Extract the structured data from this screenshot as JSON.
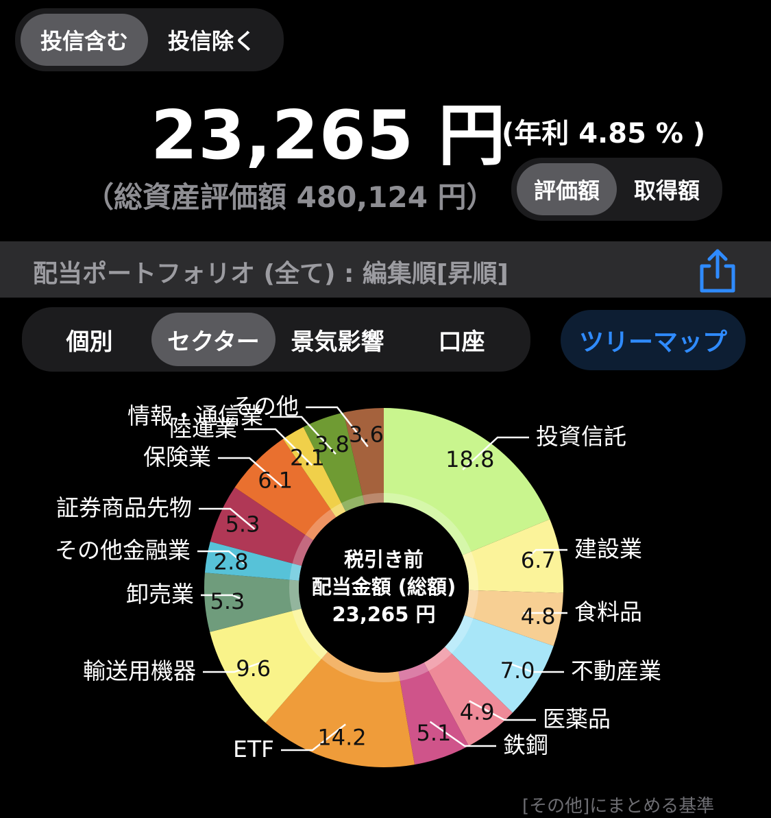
{
  "filter_toggle": {
    "include_funds": "投信含む",
    "exclude_funds": "投信除く"
  },
  "summary": {
    "amount": "23,265 円",
    "annual_rate": "(年利 4.85 % )",
    "total_assets": "（総資産評価額 480,124 円）"
  },
  "value_toggle": {
    "valuation": "評価額",
    "acquisition": "取得額"
  },
  "portfolio_bar": {
    "title": "配当ポートフォリオ (全て) : 編集順[昇順]",
    "share_icon": "share-icon"
  },
  "view_tabs": {
    "individual": "個別",
    "sector": "セクター",
    "business_sensitivity": "景気影響",
    "account": "口座"
  },
  "treemap_button": "ツリーマップ",
  "chart_data": {
    "type": "pie",
    "center_text": [
      "税引き前",
      "配当金額 (総額)",
      "23,265 円"
    ],
    "slices": [
      {
        "name": "投資信託",
        "value": 18.8,
        "color": "#c9f58e"
      },
      {
        "name": "建設業",
        "value": 6.7,
        "color": "#fbf39a"
      },
      {
        "name": "食料品",
        "value": 4.8,
        "color": "#f7cf93"
      },
      {
        "name": "不動産業",
        "value": 7.0,
        "color": "#a8e6f8"
      },
      {
        "name": "医薬品",
        "value": 4.9,
        "color": "#ee8a98"
      },
      {
        "name": "鉄鋼",
        "value": 5.1,
        "color": "#cf548a"
      },
      {
        "name": "ETF",
        "value": 14.2,
        "color": "#ef9c3a"
      },
      {
        "name": "輸送用機器",
        "value": 9.6,
        "color": "#f9f38a"
      },
      {
        "name": "卸売業",
        "value": 5.3,
        "color": "#6f9c7c"
      },
      {
        "name": "その他金融業",
        "value": 2.8,
        "color": "#57c2d8"
      },
      {
        "name": "証券商品先物",
        "value": 5.3,
        "color": "#b03856"
      },
      {
        "name": "保険業",
        "value": 6.1,
        "color": "#e9702f"
      },
      {
        "name": "陸運業",
        "value": 2.1,
        "color": "#f0d04a"
      },
      {
        "name": "情報・通信業",
        "value": 3.8,
        "color": "#6f9b33"
      },
      {
        "name": "その他",
        "value": 3.6,
        "color": "#a5623d"
      }
    ]
  },
  "footnote": "[その他]にまとめる基準"
}
